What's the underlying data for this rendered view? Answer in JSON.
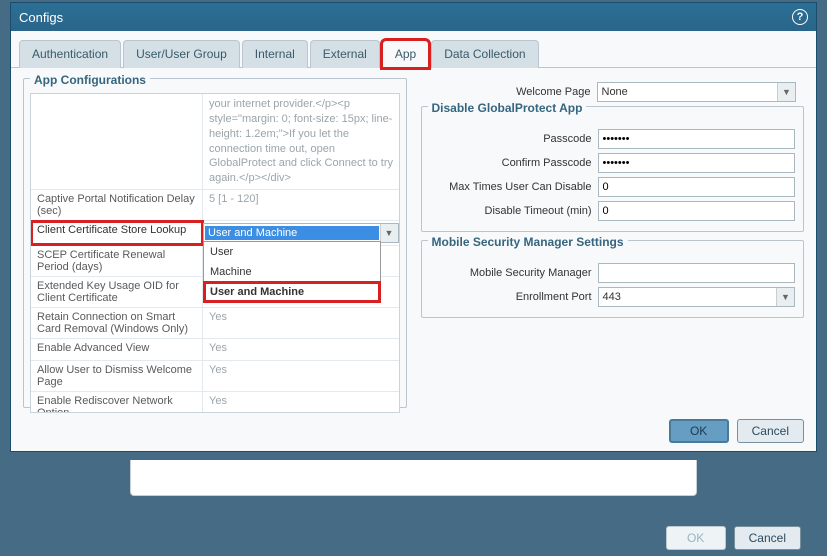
{
  "modal": {
    "title": "Configs"
  },
  "tabs": {
    "items": [
      {
        "label": "Authentication"
      },
      {
        "label": "User/User Group"
      },
      {
        "label": "Internal"
      },
      {
        "label": "External"
      },
      {
        "label": "App"
      },
      {
        "label": "Data Collection"
      }
    ]
  },
  "app_config": {
    "legend": "App Configurations",
    "html_snippet": "your internet provider.</p><p style=\"margin: 0; font-size: 15px; line-height: 1.2em;\">If you let the connection time out, open GlobalProtect and click Connect to try again.</p></div>",
    "rows": {
      "captive_delay": {
        "label": "Captive Portal Notification Delay (sec)",
        "value": "5 [1 - 120]"
      },
      "cert_lookup": {
        "label": "Client Certificate Store Lookup",
        "selected": "User and Machine"
      },
      "scep_renewal": {
        "label": "SCEP Certificate Renewal Period (days)",
        "value": ""
      },
      "ext_key": {
        "label": "Extended Key Usage OID for Client Certificate",
        "value": ""
      },
      "retain_sc": {
        "label": "Retain Connection on Smart Card Removal (Windows Only)",
        "value": "Yes"
      },
      "enable_adv": {
        "label": "Enable Advanced View",
        "value": "Yes"
      },
      "dismiss_welcome": {
        "label": "Allow User to Dismiss Welcome Page",
        "value": "Yes"
      },
      "rediscover": {
        "label": "Enable Rediscover Network Option",
        "value": "Yes"
      }
    },
    "dropdown_options": [
      {
        "label": "User"
      },
      {
        "label": "Machine"
      },
      {
        "label": "User and Machine"
      }
    ]
  },
  "right": {
    "welcome": {
      "label": "Welcome Page",
      "value": "None"
    },
    "disable_section": {
      "legend": "Disable GlobalProtect App",
      "passcode": {
        "label": "Passcode",
        "value": "•••••••"
      },
      "confirm": {
        "label": "Confirm Passcode",
        "value": "•••••••"
      },
      "max_times": {
        "label": "Max Times User Can Disable",
        "value": "0"
      },
      "disable_timeout": {
        "label": "Disable Timeout (min)",
        "value": "0"
      }
    },
    "msm_section": {
      "legend": "Mobile Security Manager Settings",
      "msm": {
        "label": "Mobile Security Manager",
        "value": ""
      },
      "port": {
        "label": "Enrollment Port",
        "value": "443"
      }
    }
  },
  "buttons": {
    "ok": "OK",
    "cancel": "Cancel"
  }
}
